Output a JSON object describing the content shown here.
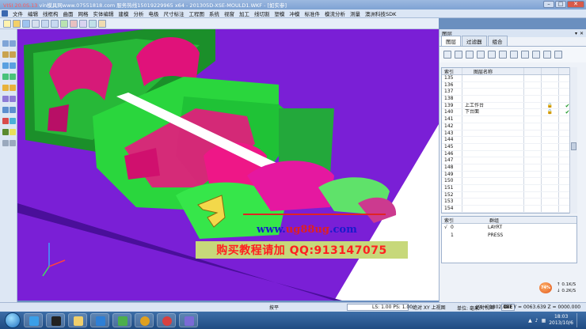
{
  "window": {
    "title_prefix": "VISI 20.0S.13",
    "title_rest": " vin模具网www.07551818.com 服务热线15019229965 x64 - 201305D-XSE-MOULD1.WKF - [如实参]",
    "min": "–",
    "max": "□",
    "close": "✕"
  },
  "menu": [
    "文件",
    "编辑",
    "线框构",
    "曲面",
    "网格",
    "实体编辑",
    "建模",
    "分析",
    "电极",
    "尺寸标注",
    "工程图",
    "系统",
    "视窗",
    "加工",
    "线切割",
    "塑模",
    "冲模",
    "标准件",
    "模流分析",
    "测量",
    "澳洲科技SDK"
  ],
  "watermark": {
    "url_prefix": "www.",
    "url_red": "ug88ug",
    "url_suffix": ".com",
    "promo": "购买教程请加 QQ:913147075"
  },
  "panel": {
    "title": "图层",
    "tabs": [
      "图层",
      "过滤器",
      "组合"
    ],
    "grid_headers": [
      "索引",
      "图层名称",
      "",
      "",
      ""
    ],
    "rows": [
      {
        "index": "135",
        "name": "",
        "lock": "",
        "visible": ""
      },
      {
        "index": "136",
        "name": "",
        "lock": "",
        "visible": ""
      },
      {
        "index": "137",
        "name": "",
        "lock": "",
        "visible": ""
      },
      {
        "index": "138",
        "name": "",
        "lock": "",
        "visible": ""
      },
      {
        "index": "139",
        "name": "上工作台",
        "lock": "🔒",
        "visible": "✔"
      },
      {
        "index": "140",
        "name": "下台面",
        "lock": "🔒",
        "visible": "✔"
      },
      {
        "index": "141",
        "name": "",
        "lock": "",
        "visible": ""
      },
      {
        "index": "142",
        "name": "",
        "lock": "",
        "visible": ""
      },
      {
        "index": "143",
        "name": "",
        "lock": "",
        "visible": ""
      },
      {
        "index": "144",
        "name": "",
        "lock": "",
        "visible": ""
      },
      {
        "index": "145",
        "name": "",
        "lock": "",
        "visible": ""
      },
      {
        "index": "146",
        "name": "",
        "lock": "",
        "visible": ""
      },
      {
        "index": "147",
        "name": "",
        "lock": "",
        "visible": ""
      },
      {
        "index": "148",
        "name": "",
        "lock": "",
        "visible": ""
      },
      {
        "index": "149",
        "name": "",
        "lock": "",
        "visible": ""
      },
      {
        "index": "150",
        "name": "",
        "lock": "",
        "visible": ""
      },
      {
        "index": "151",
        "name": "",
        "lock": "",
        "visible": ""
      },
      {
        "index": "152",
        "name": "",
        "lock": "",
        "visible": ""
      },
      {
        "index": "153",
        "name": "",
        "lock": "",
        "visible": ""
      },
      {
        "index": "154",
        "name": "",
        "lock": "",
        "visible": ""
      }
    ],
    "group_headers": [
      "索引",
      "群组"
    ],
    "groups": [
      {
        "check": "√",
        "index": "0",
        "name": "LAYRT"
      },
      {
        "check": "",
        "index": "1",
        "name": "PRESS"
      }
    ],
    "net": {
      "percent": "74%",
      "up": "0.1K/S",
      "down": "0.2K/S"
    }
  },
  "status": {
    "left": "按平",
    "view": "绝对 XY 上视图",
    "ls": "LS: 1.00 PS: 1.00",
    "abs_view": "绝对视图",
    "die": "DIE",
    "unit": "单位: 毫米",
    "coords": "X = 1802.011 Y = 0063.639 Z = 0000.000"
  },
  "taskbar": {
    "time": "18:03",
    "date": "2013/10/6"
  },
  "colors": {
    "floor": "#7a1fd6",
    "green": "#25e03a",
    "magenta": "#e0127a",
    "dark_green": "#1b8f2a"
  }
}
